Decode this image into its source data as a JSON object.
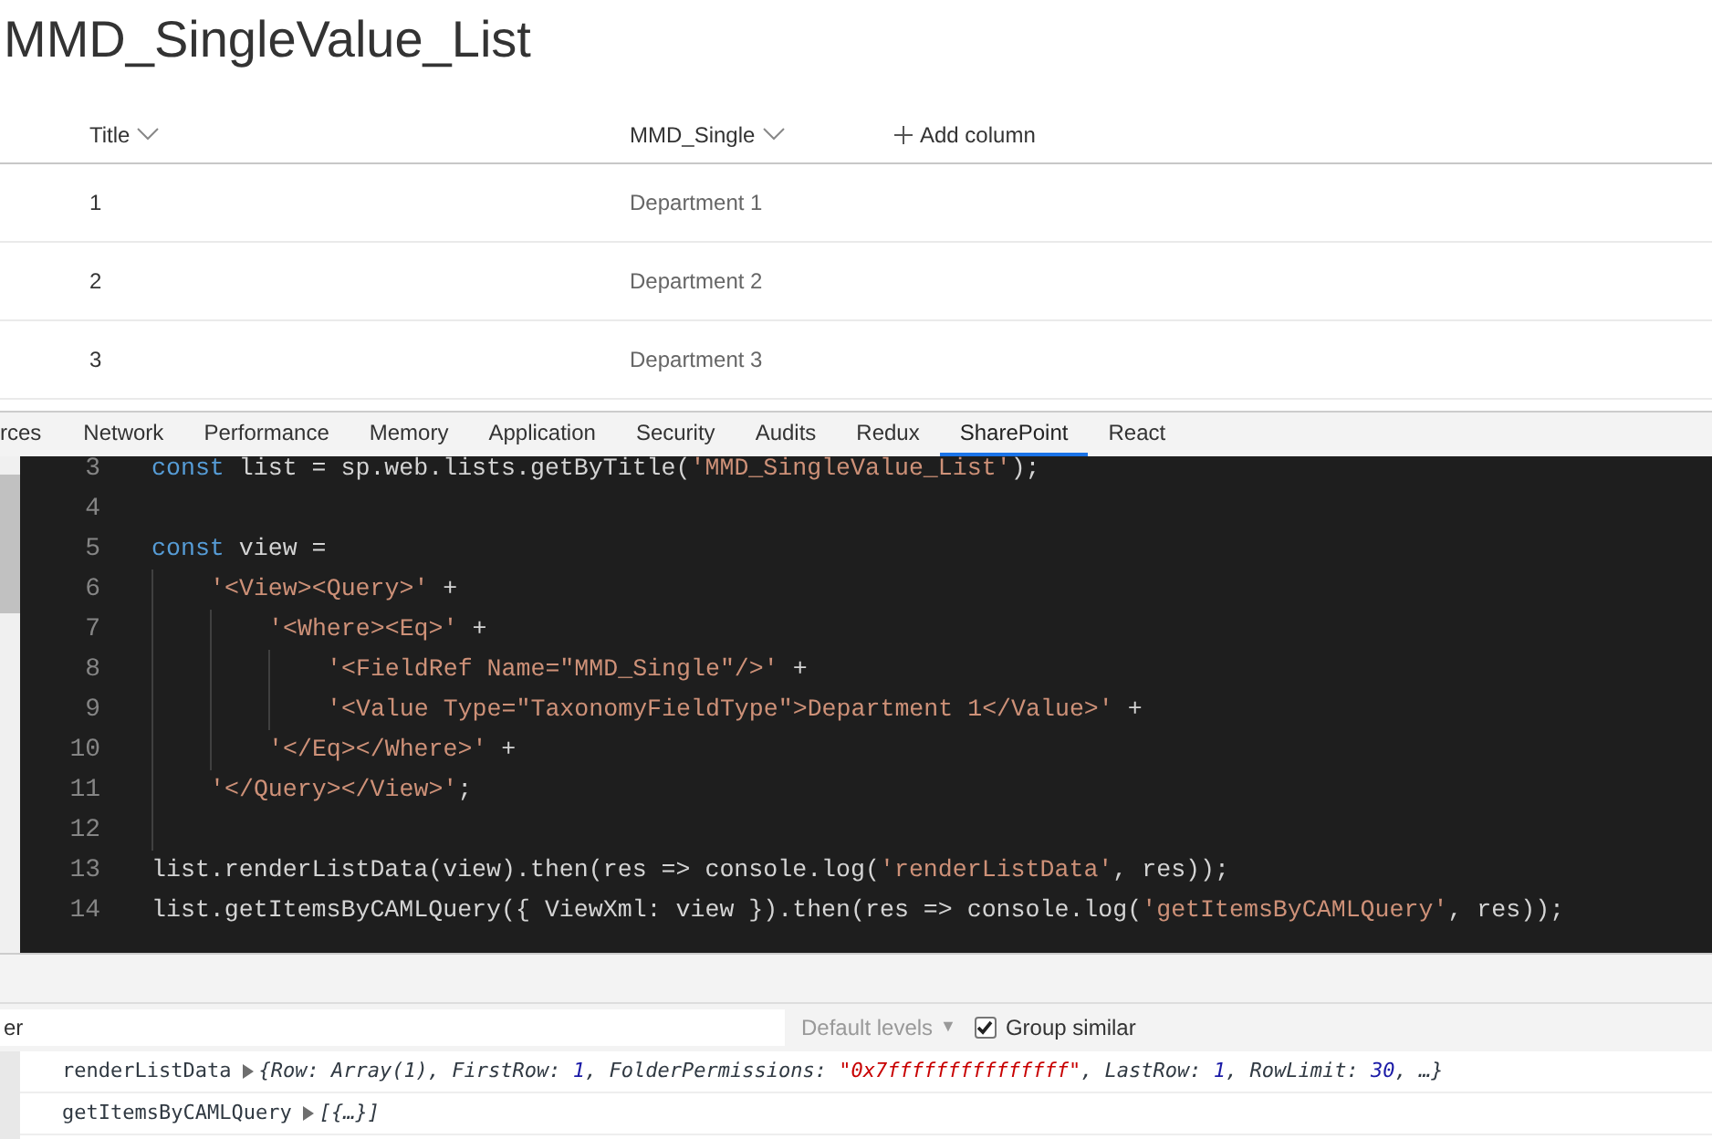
{
  "list_title": "MMD_SingleValue_List",
  "table": {
    "columns": [
      {
        "label": "Title"
      },
      {
        "label": "MMD_Single"
      }
    ],
    "add_column": "Add column",
    "rows": [
      [
        "1",
        "Department 1"
      ],
      [
        "2",
        "Department 2"
      ],
      [
        "3",
        "Department 3"
      ]
    ]
  },
  "devtools_tabs": [
    {
      "label": "rces",
      "selected": false
    },
    {
      "label": "Network",
      "selected": false
    },
    {
      "label": "Performance",
      "selected": false
    },
    {
      "label": "Memory",
      "selected": false
    },
    {
      "label": "Application",
      "selected": false
    },
    {
      "label": "Security",
      "selected": false
    },
    {
      "label": "Audits",
      "selected": false
    },
    {
      "label": "Redux",
      "selected": false
    },
    {
      "label": "SharePoint",
      "selected": true
    },
    {
      "label": "React",
      "selected": false
    }
  ],
  "editor": {
    "lines": [
      {
        "number": "3",
        "tokens": [
          {
            "kind": "kw",
            "text": "const"
          },
          {
            "kind": "plain",
            "text": " list = sp.web.lists.getByTitle("
          },
          {
            "kind": "str",
            "text": "'MMD_SingleValue_List'"
          },
          {
            "kind": "plain",
            "text": ");"
          }
        ]
      },
      {
        "number": "4"
      },
      {
        "number": "5",
        "tokens": [
          {
            "kind": "kw",
            "text": "const"
          },
          {
            "kind": "plain",
            "text": " view ="
          }
        ],
        "children": [
          {
            "number": "6",
            "tokens": [
              {
                "kind": "str",
                "text": "'<View><Query>'"
              },
              {
                "kind": "plain",
                "text": " +"
              }
            ],
            "children": [
              {
                "number": "7",
                "tokens": [
                  {
                    "kind": "str",
                    "text": "'<Where><Eq>'"
                  },
                  {
                    "kind": "plain",
                    "text": " +"
                  }
                ],
                "children": [
                  {
                    "number": "8",
                    "tokens": [
                      {
                        "kind": "str",
                        "text": "'<FieldRef Name=\"MMD_Single\"/>'"
                      },
                      {
                        "kind": "plain",
                        "text": " +"
                      }
                    ]
                  },
                  {
                    "number": "9",
                    "tokens": [
                      {
                        "kind": "str",
                        "text": "'<Value Type=\"TaxonomyFieldType\">Department 1</Value>'"
                      },
                      {
                        "kind": "plain",
                        "text": " +"
                      }
                    ]
                  }
                ]
              },
              {
                "number": "10",
                "tokens": [
                  {
                    "kind": "str",
                    "text": "'</Eq></Where>'"
                  },
                  {
                    "kind": "plain",
                    "text": " +"
                  }
                ]
              }
            ]
          },
          {
            "number": "11",
            "tokens": [
              {
                "kind": "str",
                "text": "'</Query></View>'"
              },
              {
                "kind": "plain",
                "text": ";"
              }
            ]
          },
          {
            "number": "12"
          }
        ]
      },
      {
        "number": "13",
        "tokens": [
          {
            "kind": "plain",
            "text": "list.renderListData(view).then(res => console.log("
          },
          {
            "kind": "str",
            "text": "'renderListData'"
          },
          {
            "kind": "plain",
            "text": ", res));"
          }
        ]
      },
      {
        "number": "14",
        "tokens": [
          {
            "kind": "plain",
            "text": "list.getItemsByCAMLQuery({ ViewXml: view }).then(res => console.log("
          },
          {
            "kind": "str",
            "text": "'getItemsByCAMLQuery'"
          },
          {
            "kind": "plain",
            "text": ", res));"
          }
        ]
      }
    ]
  },
  "console": {
    "filter": {
      "value": "er"
    },
    "levels": "Default levels",
    "levels_caret": "▼",
    "group_similar": {
      "label": "Group similar",
      "checked": true
    },
    "messages": [
      {
        "label": "renderListData",
        "tokens": [
          {
            "kind": "plain",
            "text": "{Row: Array(1), FirstRow: "
          },
          {
            "kind": "num",
            "text": "1"
          },
          {
            "kind": "plain",
            "text": ", FolderPermissions: "
          },
          {
            "kind": "str",
            "text": "\"0x7fffffffffffffff\""
          },
          {
            "kind": "plain",
            "text": ", LastRow: "
          },
          {
            "kind": "num",
            "text": "1"
          },
          {
            "kind": "plain",
            "text": ", RowLimit: "
          },
          {
            "kind": "num",
            "text": "30"
          },
          {
            "kind": "plain",
            "text": ", …}"
          }
        ]
      },
      {
        "label": "getItemsByCAMLQuery",
        "tokens": [
          {
            "kind": "plain",
            "text": "[{…}]"
          }
        ]
      }
    ]
  }
}
